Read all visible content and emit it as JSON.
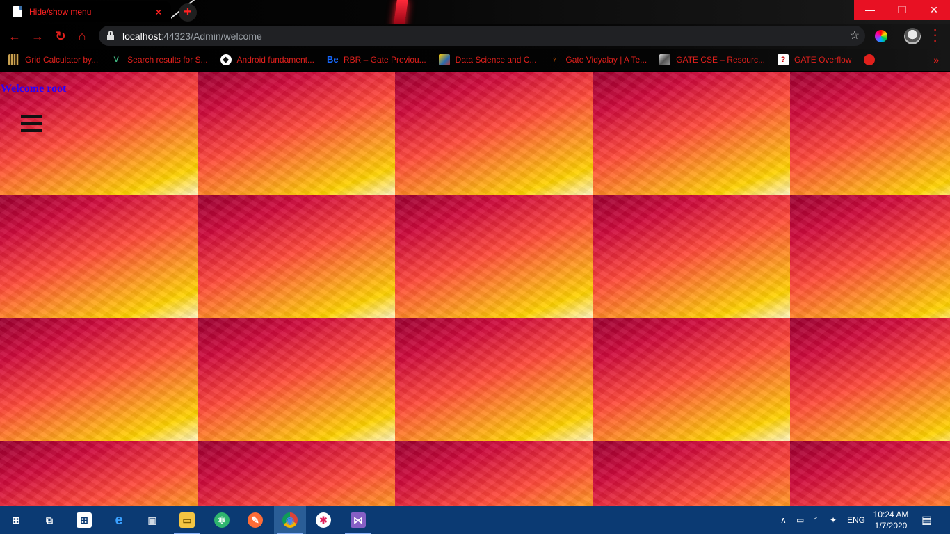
{
  "browser": {
    "tab_title": "Hide/show menu",
    "tab_close_glyph": "×",
    "new_tab_glyph": "+",
    "url_host": "localhost",
    "url_rest": ":44323/Admin/welcome",
    "window_controls": {
      "minimize": "—",
      "restore": "❐",
      "close": "✕"
    },
    "accent_color": "#e0201c",
    "bookmarks": [
      {
        "label": "Grid Calculator by...",
        "icon": "grid-calculator-icon"
      },
      {
        "label": "Search results for S...",
        "icon": "vuejs-icon"
      },
      {
        "label": "Android fundament...",
        "icon": "android-icon"
      },
      {
        "label": "RBR – Gate Previou...",
        "icon": "behance-icon",
        "icon_text": "Be"
      },
      {
        "label": "Data Science and C...",
        "icon": "data-science-icon"
      },
      {
        "label": "Gate Vidyalay | A Te...",
        "icon": "gate-vidyalay-icon"
      },
      {
        "label": "GATE CSE – Resourc...",
        "icon": "gate-cse-icon"
      },
      {
        "label": "GATE Overflow",
        "icon": "gate-overflow-icon"
      }
    ],
    "bookmarks_more": "»"
  },
  "page": {
    "welcome_text": "Welcome root"
  },
  "taskbar": {
    "apps": [
      {
        "name": "start-button",
        "glyph": "⊞"
      },
      {
        "name": "task-view",
        "glyph": "⧉"
      },
      {
        "name": "microsoft-store",
        "glyph": "⊞"
      },
      {
        "name": "edge",
        "glyph": "e"
      },
      {
        "name": "virtualbox",
        "glyph": "▣"
      },
      {
        "name": "file-explorer",
        "glyph": "▭"
      },
      {
        "name": "atom",
        "glyph": "⚛"
      },
      {
        "name": "postman",
        "glyph": "✎"
      },
      {
        "name": "chrome",
        "glyph": "◉"
      },
      {
        "name": "slack",
        "glyph": "✱"
      },
      {
        "name": "visual-studio",
        "glyph": "⋈"
      }
    ],
    "language": "ENG",
    "time": "10:24 AM",
    "date": "1/7/2020"
  }
}
